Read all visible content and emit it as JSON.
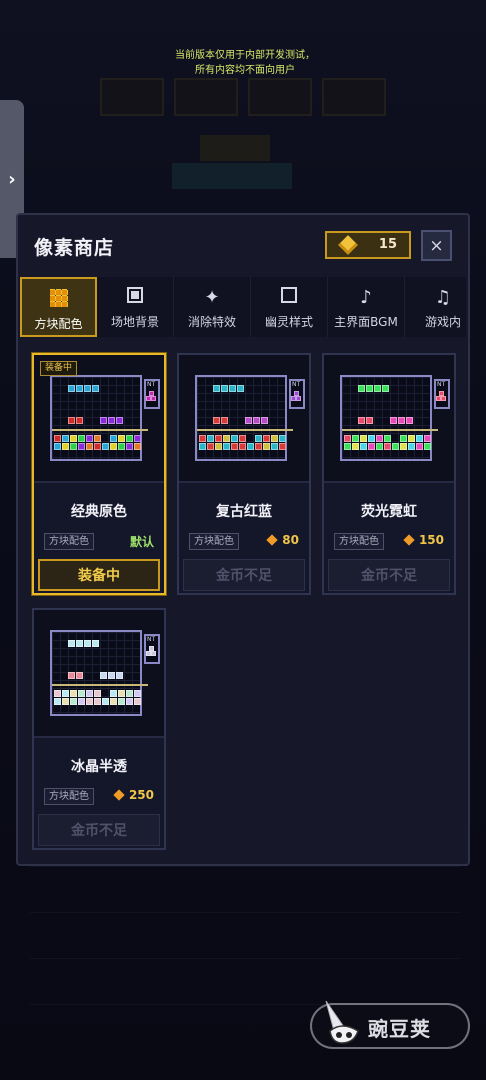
{
  "notice": {
    "line1": "当前版本仅用于内部开发测试，",
    "line2": "所有内容均不面向用户"
  },
  "background": {
    "rows": [
      "",
      "",
      "",
      ""
    ]
  },
  "side_tab": {
    "icon": "chevron-right-icon",
    "glyph": "›"
  },
  "shop": {
    "title": "像素商店",
    "coins": "15",
    "close_glyph": "×",
    "tabs": [
      {
        "label": "方块配色",
        "icon": "grid-icon",
        "active": true
      },
      {
        "label": "场地背景",
        "icon": "square-icon",
        "active": false
      },
      {
        "label": "消除特效",
        "icon": "sparkle-icon",
        "glyph": "✦",
        "active": false
      },
      {
        "label": "幽灵样式",
        "icon": "hollow-square-icon",
        "active": false
      },
      {
        "label": "主界面BGM",
        "icon": "music-note-icon",
        "glyph": "♪",
        "active": false
      },
      {
        "label": "游戏内",
        "icon": "music-notes-icon",
        "glyph": "♫",
        "active": false
      }
    ],
    "items": [
      {
        "name": "经典原色",
        "badge": "装备中",
        "tag": "方块配色",
        "price": "",
        "status": "默认",
        "button": "装备中",
        "equipped": true,
        "colors": {
          "top": "#2aa6d6",
          "mid1": "#d02b2b",
          "mid2": "#8a2ad8",
          "row1": [
            "#d02b2b",
            "#2aa6d6",
            "#e0d22b",
            "#2ad04a",
            "#8a2ad8",
            "#e07a2b"
          ],
          "next": "#c02ab0"
        }
      },
      {
        "name": "复古红蓝",
        "badge": "",
        "tag": "方块配色",
        "price": "80",
        "status": "",
        "button": "金币不足",
        "equipped": false,
        "colors": {
          "top": "#2ab6c8",
          "mid1": "#d83a3a",
          "mid2": "#b84cc8",
          "row1": [
            "#d83a3a",
            "#2ab6c8",
            "#d83a3a",
            "#d0c040",
            "#2ab6c8",
            "#d83a3a"
          ],
          "next": "#9a4ad0"
        }
      },
      {
        "name": "荧光霓虹",
        "badge": "",
        "tag": "方块配色",
        "price": "150",
        "status": "",
        "button": "金币不足",
        "equipped": false,
        "colors": {
          "top": "#3ae05a",
          "mid1": "#e84a6a",
          "mid2": "#e84ab8",
          "row1": [
            "#e84a6a",
            "#3ae05a",
            "#e0e04a",
            "#4ad8e8",
            "#e84ab8",
            "#3ae05a"
          ],
          "next": "#e84a6a"
        }
      },
      {
        "name": "冰晶半透",
        "badge": "",
        "tag": "方块配色",
        "price": "250",
        "status": "",
        "button": "金币不足",
        "equipped": false,
        "colors": {
          "top": "#b8e8f0",
          "mid1": "#e88a9a",
          "mid2": "#c8d8f0",
          "row1": [
            "#e8c8d0",
            "#b8e8f0",
            "#e8e0b0",
            "#b8e8d0",
            "#d0c8f0",
            "#e8c8d0"
          ],
          "next": "#c8c8e0"
        }
      }
    ]
  },
  "watermark": {
    "text": "豌豆荚"
  }
}
